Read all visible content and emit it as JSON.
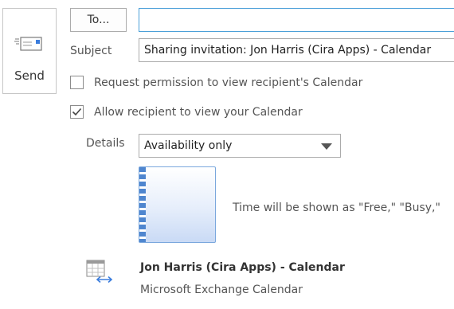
{
  "send": {
    "label": "Send",
    "icon": "send-icon"
  },
  "recipients": {
    "to_label": "To...",
    "to_value": ""
  },
  "subject": {
    "label": "Subject",
    "value": "Sharing invitation: Jon Harris (Cira Apps) - Calendar"
  },
  "options": {
    "request_permission": {
      "label": "Request permission to view recipient's Calendar",
      "checked": false
    },
    "allow_view": {
      "label": "Allow recipient to view your Calendar",
      "checked": true
    }
  },
  "details": {
    "label": "Details",
    "selected": "Availability only"
  },
  "preview": {
    "caption": "Time will be shown as \"Free,\" \"Busy,\""
  },
  "calendar": {
    "name": "Jon Harris (Cira Apps) - Calendar",
    "type": "Microsoft Exchange Calendar",
    "icon": "calendar-share-icon"
  },
  "colors": {
    "accent": "#4a9fd8",
    "calendar_blue": "#4f86cf"
  }
}
